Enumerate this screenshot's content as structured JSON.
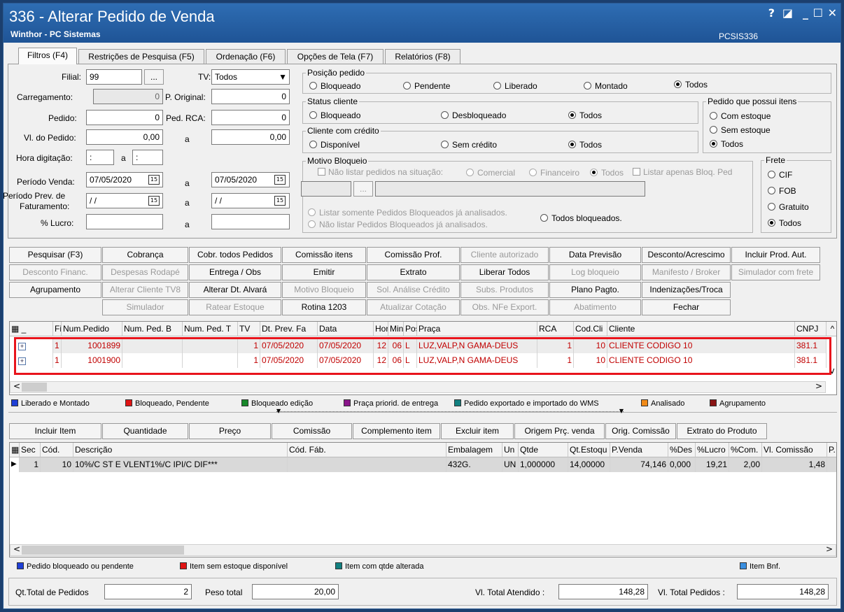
{
  "window": {
    "title": "336 - Alterar Pedido de Venda",
    "subtitle": "Winthor - PC Sistemas",
    "code": "PCSIS336",
    "controls": {
      "help": "?",
      "restore": "◪",
      "minimize": "_",
      "maximize": "☐",
      "close": "✕"
    }
  },
  "tabs": [
    "Filtros (F4)",
    "Restrições de Pesquisa (F5)",
    "Ordenação (F6)",
    "Opções de Tela (F7)",
    "Relatórios (F8)"
  ],
  "filters": {
    "filial_label": "Filial:",
    "filial_value": "99",
    "filial_btn": "...",
    "tv_label": "TV:",
    "tv_value": "Todos",
    "carregamento_label": "Carregamento:",
    "carregamento_value": "0",
    "p_original_label": "P. Original:",
    "p_original_value": "0",
    "pedido_label": "Pedido:",
    "pedido_value": "0",
    "ped_rca_label": "Ped. RCA:",
    "ped_rca_value": "0",
    "vl_pedido_label": "Vl. do Pedido:",
    "vl_pedido_from": "0,00",
    "a": "a",
    "vl_pedido_to": "0,00",
    "hora_label": "Hora digitação:",
    "hora_from": " :",
    "hora_to": " :",
    "periodo_venda_label": "Período Venda:",
    "periodo_venda_from": "07/05/2020",
    "periodo_venda_to": "07/05/2020",
    "periodo_prev_label1": "Período Prev. de",
    "periodo_prev_label2": "Faturamento:",
    "periodo_prev_from": "/ /",
    "periodo_prev_to": "/ /",
    "lucro_label": "% Lucro:",
    "cal_icon": "15"
  },
  "posicao": {
    "title": "Posição pedido",
    "options": [
      "Bloqueado",
      "Pendente",
      "Liberado",
      "Montado",
      "Todos"
    ],
    "selected": 4
  },
  "status_cliente": {
    "title": "Status cliente",
    "options": [
      "Bloqueado",
      "Desbloqueado",
      "Todos"
    ],
    "selected": 2
  },
  "credito": {
    "title": "Cliente com crédito",
    "options": [
      "Disponível",
      "Sem crédito",
      "Todos"
    ],
    "selected": 2
  },
  "itens": {
    "title": "Pedido que possui itens",
    "options": [
      "Com estoque",
      "Sem estoque",
      "Todos"
    ],
    "selected": 2
  },
  "motivo": {
    "title": "Motivo Bloqueio",
    "nao_listar": "Não listar pedidos na situação:",
    "options": [
      "Comercial",
      "Financeiro",
      "Todos"
    ],
    "listar_apenas": "Listar apenas Bloq. Ped",
    "btn": "...",
    "opt1": "Listar somente Pedidos Bloqueados já analisados.",
    "opt2": "Não listar Pedidos Bloqueados já analisados.",
    "opt3": "Todos bloqueados."
  },
  "frete": {
    "title": "Frete",
    "options": [
      "CIF",
      "FOB",
      "Gratuito",
      "Todos"
    ],
    "selected": 3
  },
  "buttons": [
    [
      "Pesquisar (F3)",
      "Cobrança",
      "Cobr. todos Pedidos",
      "Comissão itens",
      "Comissão Prof.",
      "Cliente autorizado",
      "Data Previsão",
      "Desconto/Acrescimo",
      "Incluir Prod. Aut."
    ],
    [
      "Desconto Financ.",
      "Despesas Rodapé",
      "Entrega / Obs",
      "Emitir",
      "Extrato",
      "Liberar Todos",
      "Log bloqueio",
      "Manifesto / Broker",
      "Simulador com frete"
    ],
    [
      "Agrupamento",
      "Alterar Cliente TV8",
      "Alterar Dt. Alvará",
      "Motivo Bloqueio",
      "Sol. Análise Crédito",
      "Subs. Produtos",
      "Plano Pagto.",
      "Indenizações/Troca"
    ],
    [
      "Simulador",
      "Ratear Estoque",
      "Rotina 1203",
      "Atualizar Cotação",
      "Obs. NFe Export.",
      "Abatimento",
      "Fechar"
    ]
  ],
  "orders": {
    "columns": [
      "",
      "Filia",
      "Num.Pedido",
      "Num. Ped. B",
      "Num. Ped. T",
      "TV",
      "Dt. Prev. Fa",
      "Data",
      "Hor",
      "Min",
      "Pos",
      "Praça",
      "RCA",
      "Cod.Cli",
      "Cliente",
      "CNPJ"
    ],
    "rows": [
      [
        "1",
        "1001899",
        "",
        "",
        "1",
        "07/05/2020",
        "07/05/2020",
        "12",
        "06",
        "L",
        "LUZ,VALP,N GAMA-DEUS",
        "1",
        "10",
        "CLIENTE CODIGO 10",
        "381.1"
      ],
      [
        "1",
        "1001900",
        "",
        "",
        "1",
        "07/05/2020",
        "07/05/2020",
        "12",
        "06",
        "L",
        "LUZ,VALP,N GAMA-DEUS",
        "1",
        "10",
        "CLIENTE CODIGO 10",
        "381.1"
      ]
    ]
  },
  "legend1": [
    {
      "color": "#1f3fd6",
      "label": "Liberado e Montado"
    },
    {
      "color": "#e01414",
      "label": "Bloqueado, Pendente"
    },
    {
      "color": "#18882a",
      "label": "Bloqueado edição"
    },
    {
      "color": "#8a148a",
      "label": "Praça priorid. de entrega"
    },
    {
      "color": "#118080",
      "label": "Pedido exportado e importado do WMS"
    },
    {
      "color": "#f08a18",
      "label": "Analisado"
    },
    {
      "color": "#8a1414",
      "label": "Agrupamento"
    }
  ],
  "item_buttons": [
    "Incluir Item",
    "Quantidade",
    "Preço",
    "Comissão",
    "Complemento item",
    "Excluir item",
    "Origem Prç. venda",
    "Orig. Comissão",
    "Extrato do Produto"
  ],
  "items": {
    "columns": [
      "Sec",
      "Cód.",
      "Descrição",
      "Cód. Fáb.",
      "Embalagem",
      "Un",
      "Qtde",
      "Qt.Estoqu",
      "P.Venda",
      "%Des",
      "%Lucro",
      "%Com.",
      "Vl. Comissão",
      "P."
    ],
    "rows": [
      [
        "1",
        "10",
        "10%/C ST E VLENT1%/C IPI/C DIF***",
        "",
        "432G.",
        "UN",
        "1,000000",
        "14,00000",
        "74,146",
        "0,000",
        "19,21",
        "2,00",
        "1,48",
        ""
      ]
    ]
  },
  "legend2": [
    {
      "color": "#1f3fd6",
      "label": "Pedido bloqueado ou pendente"
    },
    {
      "color": "#e01414",
      "label": "Item sem estoque disponível"
    },
    {
      "color": "#118080",
      "label": "Item com qtde alterada"
    },
    {
      "color": "#3a8fe0",
      "label": "Item Bnf."
    }
  ],
  "footer": {
    "qt_label": "Qt.Total de Pedidos",
    "qt_value": "2",
    "peso_label": "Peso total",
    "peso_value": "20,00",
    "vl_atendido_label": "Vl. Total Atendido :",
    "vl_atendido_value": "148,28",
    "vl_pedidos_label": "Vl. Total Pedidos :",
    "vl_pedidos_value": "148,28"
  }
}
